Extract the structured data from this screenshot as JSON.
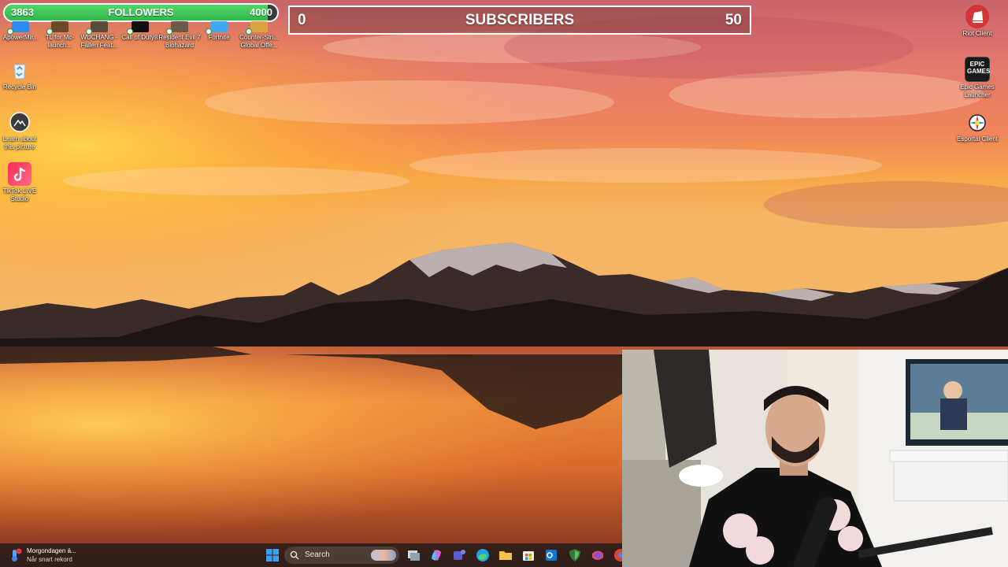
{
  "overlay": {
    "followers": {
      "current": "3863",
      "label": "FOLLOWERS",
      "goal": "4000",
      "progress": 0.9658
    },
    "subscribers": {
      "current": "0",
      "label": "SUBSCRIBERS",
      "goal": "50",
      "progress": 0.0
    }
  },
  "desktop": {
    "top_row": [
      {
        "label": "ApowerMir...",
        "icon": "apowermirror-icon"
      },
      {
        "label": "TL for Mc-launch...",
        "icon": "tlauncher-icon"
      },
      {
        "label": "WUCHANG - Fallen Feat...",
        "icon": "wuchang-icon"
      },
      {
        "label": "Call of Duty®",
        "icon": "call-of-duty-icon"
      },
      {
        "label": "Resident Evil 7 Biohazard",
        "icon": "resident-evil-icon"
      },
      {
        "label": "Fortnite",
        "icon": "fortnite-icon"
      },
      {
        "label": "Counter-Stri... Global Offe...",
        "icon": "counter-strike-icon"
      }
    ],
    "left_column": [
      {
        "label": "Recycle Bin",
        "icon": "recycle-bin-icon"
      },
      {
        "label": "Learn about this picture",
        "icon": "learn-picture-icon"
      },
      {
        "label": "TikTok LIVE Studio",
        "icon": "tiktok-icon"
      }
    ],
    "right_column": [
      {
        "label": "Riot Client",
        "icon": "riot-client-icon"
      },
      {
        "label": "Epic Games Launcher",
        "icon": "epic-games-icon",
        "badge": "EPIC GAMES"
      },
      {
        "label": "Esportal Client",
        "icon": "esportal-icon"
      }
    ]
  },
  "taskbar": {
    "weather": {
      "title": "Morgondagen ä...",
      "subtitle": "Når snart rekord",
      "badge": "1"
    },
    "search_placeholder": "Search",
    "pinned": [
      "windows-start-icon",
      "task-view-icon",
      "copilot-icon",
      "teams-icon",
      "edge-icon",
      "file-explorer-icon",
      "microsoft-store-icon",
      "outlook-icon",
      "defender-icon",
      "m365-icon"
    ]
  },
  "colors": {
    "progress_green": "#3fc655",
    "sky_orange": "#f27a4a",
    "taskbar": "#281c18"
  }
}
